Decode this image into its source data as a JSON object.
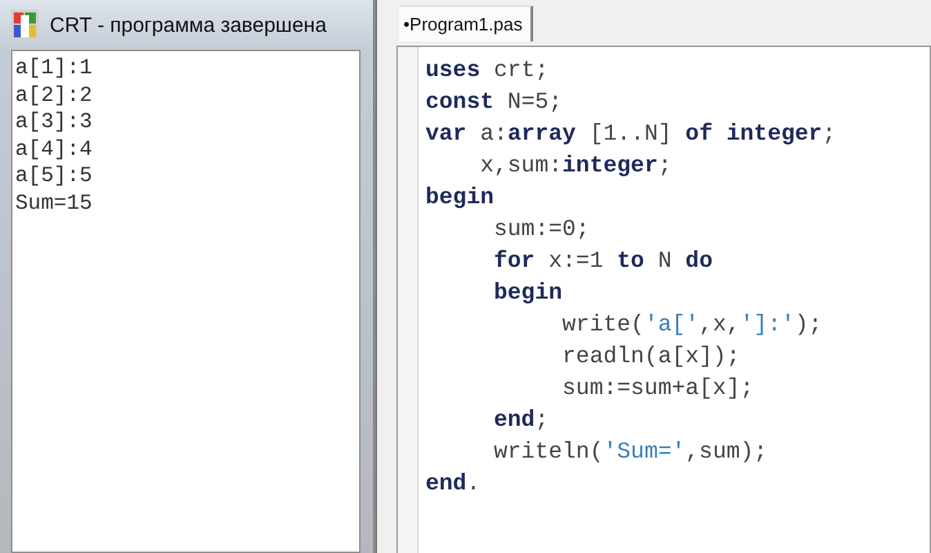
{
  "console_window": {
    "title": "CRT - программа завершена",
    "output_lines": [
      "a[1]:1",
      "a[2]:2",
      "a[3]:3",
      "a[4]:4",
      "a[5]:5",
      "Sum=15"
    ]
  },
  "editor": {
    "tabs": [
      {
        "label": "•Program1.pas",
        "selected": true
      }
    ],
    "code_lines": [
      {
        "segments": [
          {
            "kind": "keyword",
            "text": "uses"
          },
          {
            "kind": "plain",
            "text": " crt;"
          }
        ]
      },
      {
        "segments": [
          {
            "kind": "keyword",
            "text": "const"
          },
          {
            "kind": "plain",
            "text": " N=5;"
          }
        ]
      },
      {
        "segments": [
          {
            "kind": "keyword",
            "text": "var"
          },
          {
            "kind": "plain",
            "text": " a:"
          },
          {
            "kind": "keyword",
            "text": "array"
          },
          {
            "kind": "plain",
            "text": " [1..N] "
          },
          {
            "kind": "keyword",
            "text": "of integer"
          },
          {
            "kind": "plain",
            "text": ";"
          }
        ]
      },
      {
        "segments": [
          {
            "kind": "plain",
            "text": "    x,sum:"
          },
          {
            "kind": "keyword",
            "text": "integer"
          },
          {
            "kind": "plain",
            "text": ";"
          }
        ]
      },
      {
        "segments": [
          {
            "kind": "keyword",
            "text": "begin"
          }
        ]
      },
      {
        "segments": [
          {
            "kind": "plain",
            "text": "     sum:=0;"
          }
        ]
      },
      {
        "segments": [
          {
            "kind": "keyword",
            "text": "     for"
          },
          {
            "kind": "plain",
            "text": " x:=1 "
          },
          {
            "kind": "keyword",
            "text": "to"
          },
          {
            "kind": "plain",
            "text": " N "
          },
          {
            "kind": "keyword",
            "text": "do"
          }
        ]
      },
      {
        "segments": [
          {
            "kind": "keyword",
            "text": "     begin"
          }
        ]
      },
      {
        "segments": [
          {
            "kind": "plain",
            "text": "          write("
          },
          {
            "kind": "string",
            "text": "'a['"
          },
          {
            "kind": "plain",
            "text": ",x,"
          },
          {
            "kind": "string",
            "text": "']:'"
          },
          {
            "kind": "plain",
            "text": ");"
          }
        ]
      },
      {
        "segments": [
          {
            "kind": "plain",
            "text": "          readln(a[x]);"
          }
        ]
      },
      {
        "segments": [
          {
            "kind": "plain",
            "text": "          sum:=sum+a[x];"
          }
        ]
      },
      {
        "segments": [
          {
            "kind": "keyword",
            "text": "     end"
          },
          {
            "kind": "plain",
            "text": ";"
          }
        ]
      },
      {
        "segments": [
          {
            "kind": "plain",
            "text": "     writeln("
          },
          {
            "kind": "string",
            "text": "'Sum='"
          },
          {
            "kind": "plain",
            "text": ",sum);"
          }
        ]
      },
      {
        "segments": [
          {
            "kind": "keyword",
            "text": "end"
          },
          {
            "kind": "plain",
            "text": "."
          }
        ]
      }
    ]
  }
}
